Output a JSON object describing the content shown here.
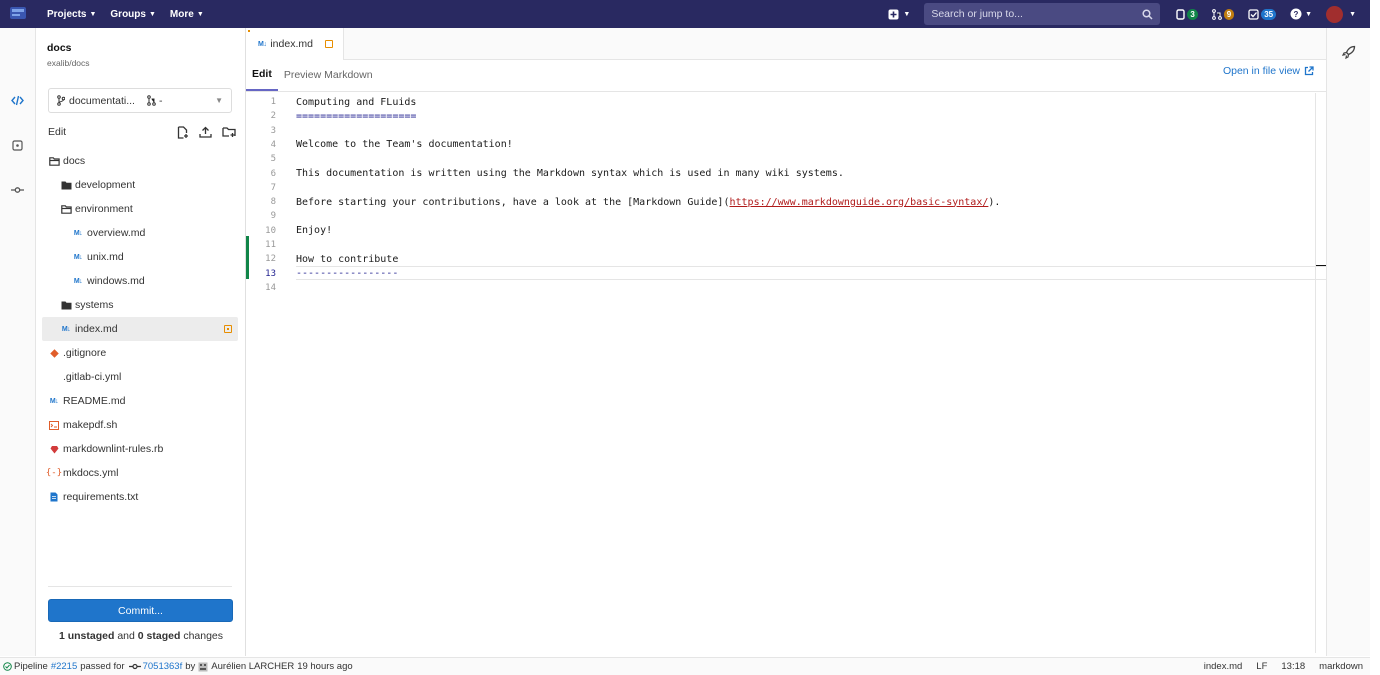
{
  "topbar": {
    "nav": [
      {
        "label": "Projects"
      },
      {
        "label": "Groups"
      },
      {
        "label": "More"
      }
    ],
    "search_placeholder": "Search or jump to...",
    "issues_count": "3",
    "mr_count": "9",
    "todos_count": "35"
  },
  "project": {
    "name": "docs",
    "path": "exalib/docs"
  },
  "branch": {
    "name": "documentati...",
    "mr": "-"
  },
  "sidebar": {
    "edit_label": "Edit",
    "tree": [
      {
        "name": "docs",
        "type": "folder-open",
        "depth": 0
      },
      {
        "name": "development",
        "type": "folder",
        "depth": 1
      },
      {
        "name": "environment",
        "type": "folder-open",
        "depth": 1
      },
      {
        "name": "overview.md",
        "type": "md",
        "depth": 2
      },
      {
        "name": "unix.md",
        "type": "md",
        "depth": 2
      },
      {
        "name": "windows.md",
        "type": "md",
        "depth": 2
      },
      {
        "name": "systems",
        "type": "folder",
        "depth": 1
      },
      {
        "name": "index.md",
        "type": "md",
        "depth": 1,
        "selected": true,
        "modified": true
      },
      {
        "name": ".gitignore",
        "type": "git",
        "depth": 0
      },
      {
        "name": ".gitlab-ci.yml",
        "type": "none",
        "depth": 0
      },
      {
        "name": "README.md",
        "type": "md",
        "depth": 0
      },
      {
        "name": "makepdf.sh",
        "type": "sh",
        "depth": 0
      },
      {
        "name": "markdownlint-rules.rb",
        "type": "rb",
        "depth": 0
      },
      {
        "name": "mkdocs.yml",
        "type": "yml",
        "depth": 0
      },
      {
        "name": "requirements.txt",
        "type": "txt",
        "depth": 0
      }
    ],
    "commit_label": "Commit...",
    "changes": {
      "unstaged": "1 unstaged",
      "and": "and",
      "staged": "0 staged",
      "suffix": "changes"
    }
  },
  "editor": {
    "tab_name": "index.md",
    "mode_tabs": [
      {
        "label": "Edit",
        "active": true
      },
      {
        "label": "Preview Markdown",
        "active": false
      }
    ],
    "open_in_file_view": "Open in file view",
    "lines": [
      {
        "n": "1",
        "text": "Computing and FLuids"
      },
      {
        "n": "2",
        "text": "====================",
        "heading": true
      },
      {
        "n": "3",
        "text": ""
      },
      {
        "n": "4",
        "text": "Welcome to the Team's documentation!"
      },
      {
        "n": "5",
        "text": ""
      },
      {
        "n": "6",
        "text": "This documentation is written using the Markdown syntax which is used in many wiki systems."
      },
      {
        "n": "7",
        "text": ""
      },
      {
        "n": "8",
        "pre": "Before starting your contributions, have a look at the [Markdown Guide](",
        "link": "https://www.markdownguide.org/basic-syntax/",
        "post": ")."
      },
      {
        "n": "9",
        "text": ""
      },
      {
        "n": "10",
        "text": "Enjoy!"
      },
      {
        "n": "11",
        "text": ""
      },
      {
        "n": "12",
        "text": "How to contribute"
      },
      {
        "n": "13",
        "text": "-----------------",
        "heading": true,
        "current": true
      },
      {
        "n": "14",
        "text": ""
      }
    ]
  },
  "status": {
    "pipeline_prefix": "Pipeline",
    "pipeline_id": "#2215",
    "passed_for": "passed for",
    "commit": "7051363f",
    "by": "by",
    "author": "Aurélien LARCHER",
    "time": "19 hours ago",
    "file": "index.md",
    "eol": "LF",
    "position": "13:18",
    "language": "markdown"
  },
  "colors": {
    "nav": "#292961",
    "primary": "#1f75cb",
    "modified": "#e78e00",
    "link": "#b01b1b"
  }
}
